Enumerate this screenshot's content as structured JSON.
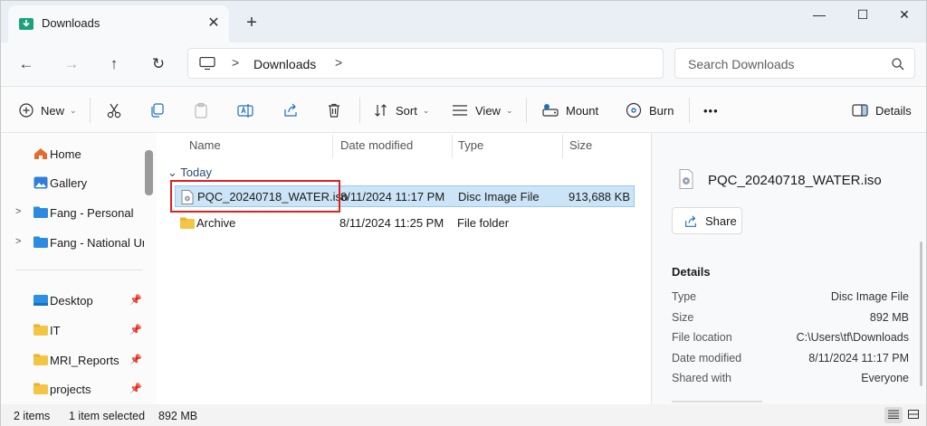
{
  "window": {
    "tab_title": "Downloads",
    "tab_close": "✕",
    "new_tab": "+",
    "minimize": "—",
    "maximize": "☐",
    "close": "✕"
  },
  "nav": {
    "back": "←",
    "forward": "→",
    "up": "↑",
    "refresh": "↻",
    "address_sep": ">",
    "crumb": "Downloads",
    "search_placeholder": "Search Downloads"
  },
  "toolbar": {
    "new_label": "New",
    "sort_label": "Sort",
    "view_label": "View",
    "mount_label": "Mount",
    "burn_label": "Burn",
    "more": "•••",
    "details_label": "Details",
    "caret": "⌄"
  },
  "sidebar": {
    "items": [
      {
        "label": "Home"
      },
      {
        "label": "Gallery"
      },
      {
        "label": "Fang - Personal"
      },
      {
        "label": "Fang - National Un"
      },
      {
        "label": "Desktop"
      },
      {
        "label": "IT"
      },
      {
        "label": "MRI_Reports"
      },
      {
        "label": "projects"
      }
    ],
    "chevron": ">",
    "pin": "📌"
  },
  "list": {
    "columns": [
      "Name",
      "Date modified",
      "Type",
      "Size"
    ],
    "group": "Today",
    "rows": [
      {
        "name": "PQC_20240718_WATER.iso",
        "date": "8/11/2024 11:17 PM",
        "type": "Disc Image File",
        "size": "913,688 KB"
      },
      {
        "name": "Archive",
        "date": "8/11/2024 11:25 PM",
        "type": "File folder",
        "size": ""
      }
    ]
  },
  "details": {
    "file_name": "PQC_20240718_WATER.iso",
    "share_label": "Share",
    "section": "Details",
    "props": [
      {
        "k": "Type",
        "v": "Disc Image File"
      },
      {
        "k": "Size",
        "v": "892 MB"
      },
      {
        "k": "File location",
        "v": "C:\\Users\\tf\\Downloads"
      },
      {
        "k": "Date modified",
        "v": "8/11/2024 11:17 PM"
      },
      {
        "k": "Shared with",
        "v": "Everyone"
      }
    ]
  },
  "status": {
    "items_count": "2 items",
    "selection": "1 item selected",
    "selection_size": "892 MB"
  },
  "colors": {
    "accent": "#0067c0",
    "selection": "#cce4f7",
    "highlight_box": "#e0201c",
    "folder": "#f4c542"
  }
}
